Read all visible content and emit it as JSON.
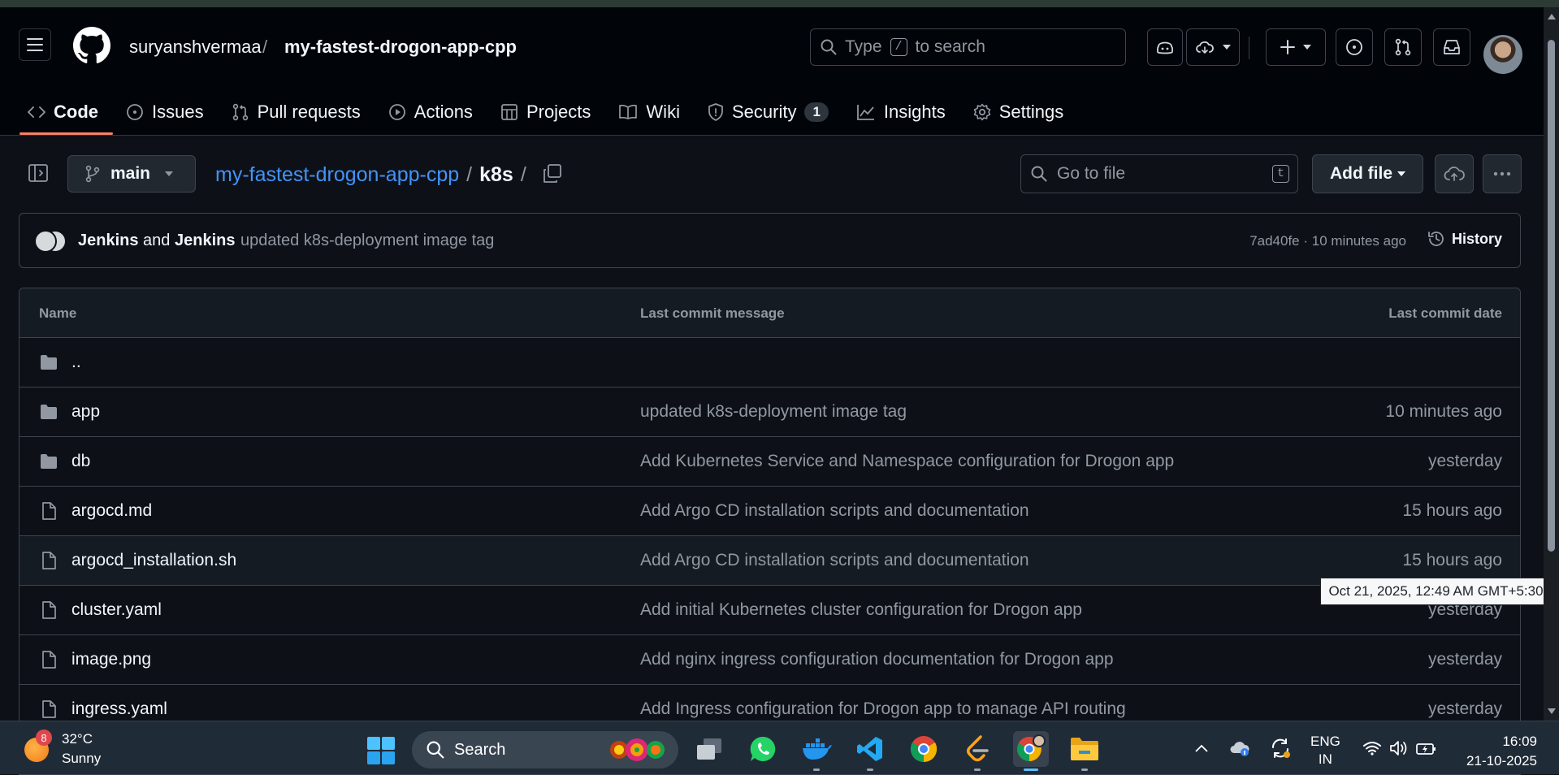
{
  "repo": {
    "owner": "suryanshvermaa",
    "separator": "/",
    "name": "my-fastest-drogon-app-cpp"
  },
  "header_search": {
    "prefix": "Type",
    "key": "/",
    "suffix": "to search"
  },
  "tabs": [
    {
      "label": "Code",
      "icon": "code-icon",
      "active": true
    },
    {
      "label": "Issues",
      "icon": "issue-icon"
    },
    {
      "label": "Pull requests",
      "icon": "pull-request-icon"
    },
    {
      "label": "Actions",
      "icon": "play-icon"
    },
    {
      "label": "Projects",
      "icon": "table-icon"
    },
    {
      "label": "Wiki",
      "icon": "book-icon"
    },
    {
      "label": "Security",
      "icon": "shield-icon",
      "counter": "1"
    },
    {
      "label": "Insights",
      "icon": "graph-icon"
    },
    {
      "label": "Settings",
      "icon": "gear-icon"
    }
  ],
  "branch": "main",
  "breadcrumb": {
    "repo": "my-fastest-drogon-app-cpp",
    "sep1": "/",
    "folder": "k8s",
    "sep2": "/"
  },
  "goto_file": {
    "placeholder": "Go to file",
    "key": "t"
  },
  "add_file_label": "Add file",
  "commit": {
    "author1": "Jenkins",
    "conjunction": "and",
    "author2": "Jenkins",
    "message": "updated k8s-deployment image tag",
    "meta": "7ad40fe · 10 minutes ago",
    "history_label": "History"
  },
  "table": {
    "headers": {
      "name": "Name",
      "message": "Last commit message",
      "date": "Last commit date"
    },
    "rows": [
      {
        "type": "folder",
        "name": "..",
        "message": "",
        "date": ""
      },
      {
        "type": "folder",
        "name": "app",
        "message": "updated k8s-deployment image tag",
        "date": "10 minutes ago"
      },
      {
        "type": "folder",
        "name": "db",
        "message": "Add Kubernetes Service and Namespace configuration for Drogon app",
        "date": "yesterday"
      },
      {
        "type": "file",
        "name": "argocd.md",
        "message": "Add Argo CD installation scripts and documentation",
        "date": "15 hours ago"
      },
      {
        "type": "file",
        "name": "argocd_installation.sh",
        "message": "Add Argo CD installation scripts and documentation",
        "date": "15 hours ago"
      },
      {
        "type": "file",
        "name": "cluster.yaml",
        "message": "Add initial Kubernetes cluster configuration for Drogon app",
        "date": "yesterday"
      },
      {
        "type": "file",
        "name": "image.png",
        "message": "Add nginx ingress configuration documentation for Drogon app",
        "date": "yesterday"
      },
      {
        "type": "file",
        "name": "ingress.yaml",
        "message": "Add Ingress configuration for Drogon app to manage API routing",
        "date": "yesterday"
      }
    ]
  },
  "tooltip": "Oct 21, 2025, 12:49 AM GMT+5:30",
  "taskbar": {
    "weather_badge": "8",
    "temperature": "32°C",
    "condition": "Sunny",
    "search_label": "Search",
    "lang_line1": "ENG",
    "lang_line2": "IN",
    "time": "16:09",
    "date": "21-10-2025"
  },
  "colors": {
    "background": "#0d1117",
    "header": "#010409",
    "link": "#4493f8",
    "active_tab_underline": "#f78166",
    "muted_text": "#9198a1",
    "border": "#3d444d"
  }
}
